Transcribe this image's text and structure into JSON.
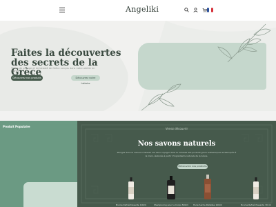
{
  "header": {
    "logo": "Angeliki",
    "icons": [
      "menu-icon",
      "search-icon",
      "user-icon",
      "cart-icon",
      "flag-icon"
    ]
  },
  "hero": {
    "title": "Faites la découvertes des secrets de la Grèce",
    "subtitle": "Tissus de voyage et de beauté de Grèce conçus dans notre atelier en France",
    "primary_button": "Découvrez nos produits",
    "secondary_button": "Découvrez notre histoire"
  },
  "featured": {
    "left_title": "Produit Populaire",
    "kicker": "Venez découvrir",
    "title": "Nos savons naturels",
    "description": "Plongez dans la nature et laissez vos sens voyager dans la richesse des produits grecs authentiques et fabriqués à la main, élaborés à partir d'ingrédients naturels de la Grèce.",
    "button": "Découvrez nos produits"
  },
  "products": [
    {
      "name": "Brume Rafraîchissante 100ml"
    },
    {
      "name": "Shampooing pour le Corps 500ml"
    },
    {
      "name": "Huile Sèche Pailletée 100ml"
    },
    {
      "name": "Brume Rafraîchissante 30 ml"
    }
  ],
  "colors": {
    "accent_dark": "#465a4c",
    "accent_green": "#6b9a83",
    "accent_light": "#c5d7cc"
  }
}
